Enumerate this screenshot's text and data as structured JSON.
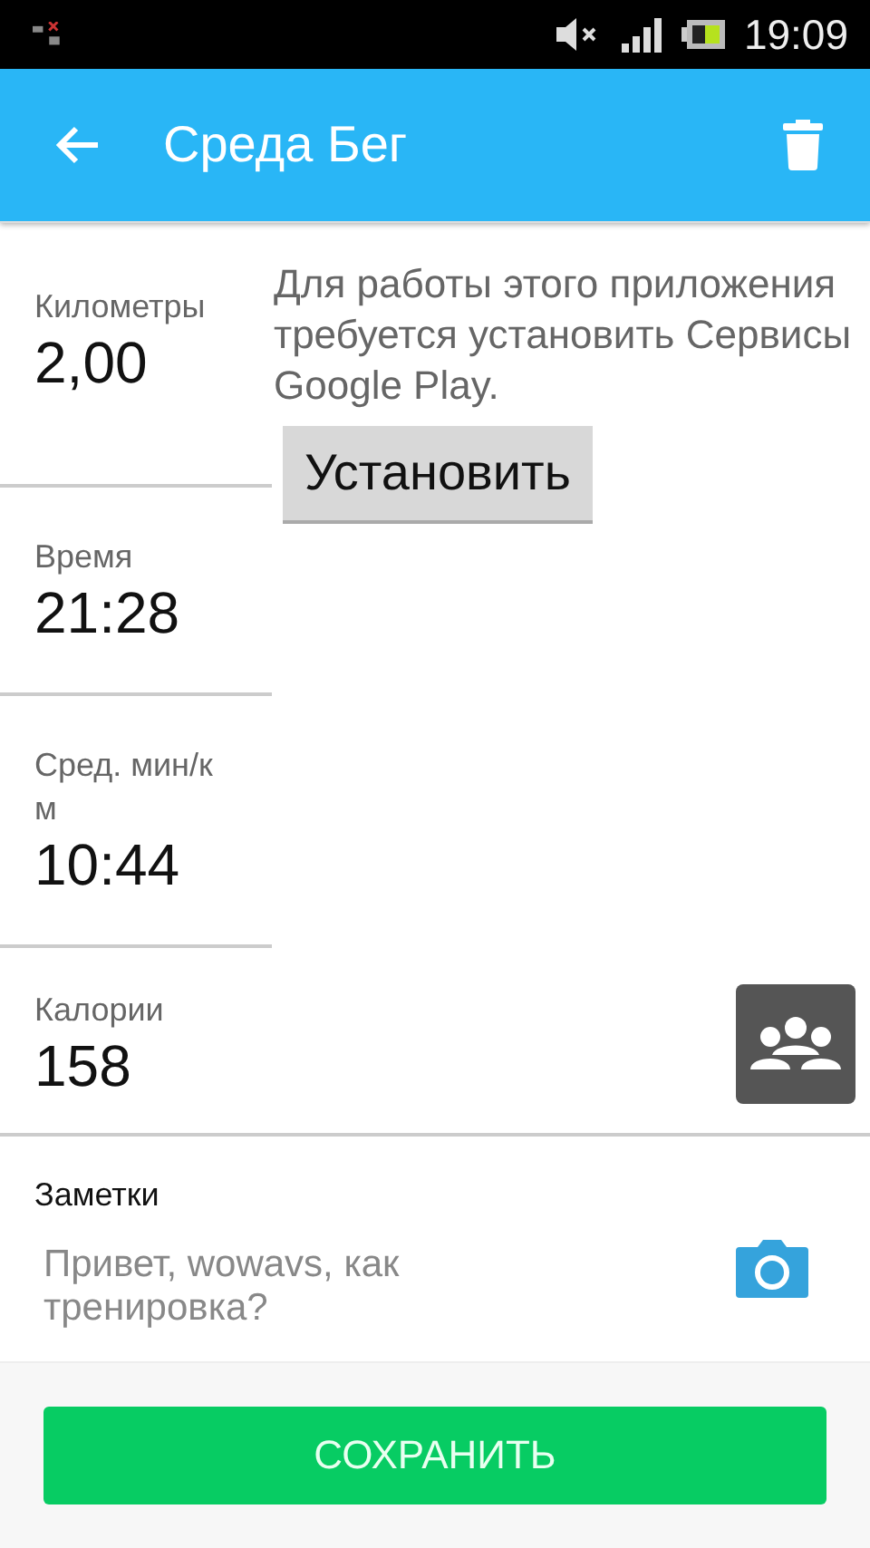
{
  "status_bar": {
    "time": "19:09"
  },
  "app_bar": {
    "title": "Среда Бег"
  },
  "stats": [
    {
      "label": "Километры",
      "value": "2,00"
    },
    {
      "label": "Время",
      "value": "21:28"
    },
    {
      "label": "Сред. мин/км",
      "value": "10:44"
    }
  ],
  "play_services": {
    "message": "Для работы этого приложения требуется установить Сервисы Google Play.",
    "button": "Установить"
  },
  "calories": {
    "label": "Калории",
    "value": "158"
  },
  "notes": {
    "label": "Заметки",
    "placeholder": "Привет, wowavs, как тренировка?"
  },
  "save_button": "СОХРАНИТЬ"
}
